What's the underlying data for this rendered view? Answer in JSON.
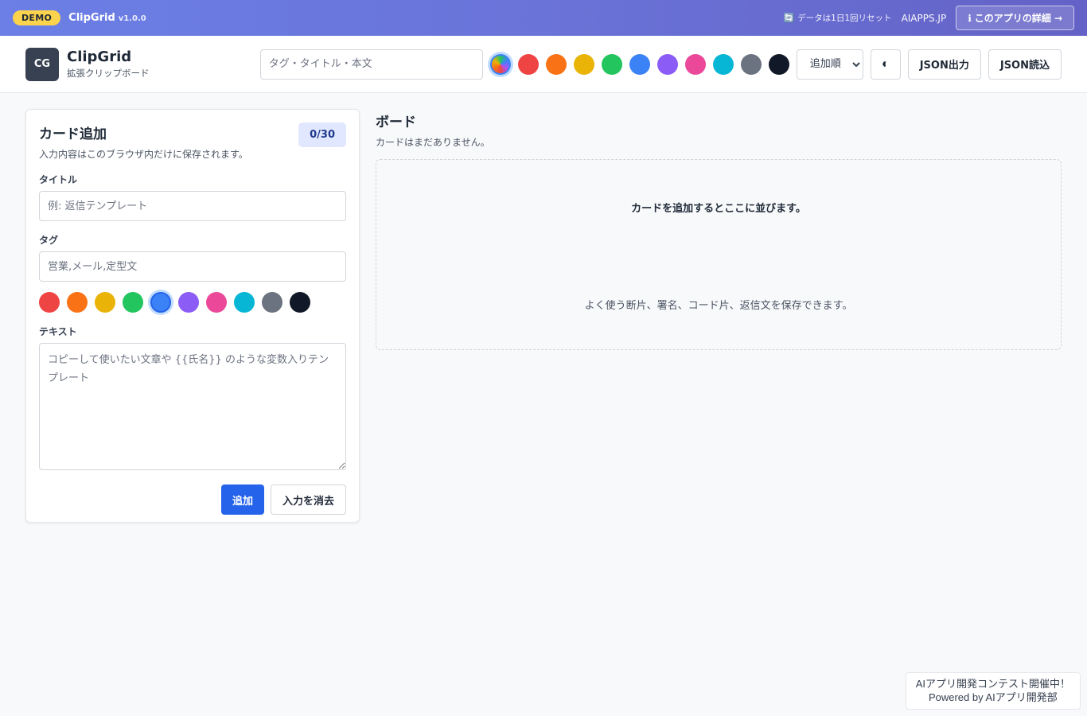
{
  "demo_bar": {
    "badge": "DEMO",
    "app_name": "ClipGrid",
    "version": "v1.0.0",
    "reset_note": "データは1日1回リセット",
    "site": "AIAPPS.JP",
    "detail_button": "このアプリの詳細 →",
    "gradient_start": "#6b7fe6",
    "gradient_end": "#6462c6"
  },
  "header": {
    "logo": "CG",
    "brand_name": "ClipGrid",
    "brand_sub": "拡張クリップボード",
    "search_placeholder": "タグ・タイトル・本文",
    "filter_colors": [
      "#ef4444",
      "#f97316",
      "#eab308",
      "#22c55e",
      "#3b82f6",
      "#8b5cf6",
      "#ec4899",
      "#06b6d4",
      "#6b7280",
      "#111827"
    ],
    "sort_selected": "追加順",
    "theme_icon": "◐",
    "export_button": "JSON出力",
    "import_button": "JSON読込"
  },
  "panel": {
    "title": "カード追加",
    "description": "入力内容はこのブラウザ内だけに保存されます。",
    "count": "0/30",
    "title_label": "タイトル",
    "title_placeholder": "例: 返信テンプレート",
    "tag_label": "タグ",
    "tag_placeholder": "営業,メール,定型文",
    "colors": [
      "#ef4444",
      "#f97316",
      "#eab308",
      "#22c55e",
      "#3b82f6",
      "#8b5cf6",
      "#ec4899",
      "#06b6d4",
      "#6b7280",
      "#111827"
    ],
    "selected_color": "#3b82f6",
    "text_label": "テキスト",
    "text_placeholder": "コピーして使いたい文章や {{氏名}} のような変数入りテンプレート",
    "add_button": "追加",
    "clear_button": "入力を消去",
    "accent": "#2563eb"
  },
  "board": {
    "title": "ボード",
    "subtitle": "カードはまだありません。",
    "empty_main": "カードを追加するとここに並びます。",
    "empty_sub": "よく使う断片、署名、コード片、返信文を保存できます。"
  },
  "contest": {
    "line1": "AIアプリ開発コンテスト開催中！",
    "line2": "Powered by AIアプリ開発部"
  }
}
